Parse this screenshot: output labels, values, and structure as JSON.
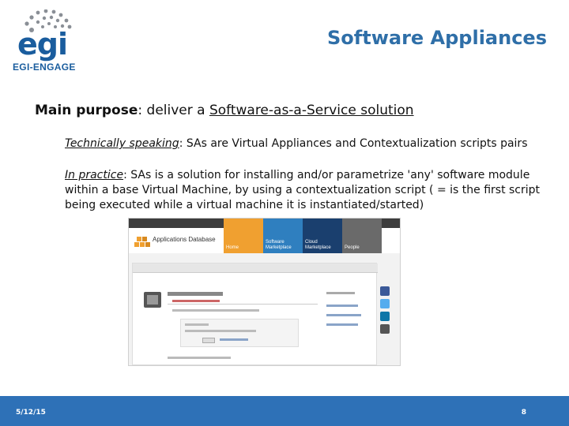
{
  "logo": {
    "brand": "egi",
    "subtitle": "EGI-ENGAGE",
    "color": "#1a5d9e"
  },
  "title": "Software Appliances",
  "main_purpose": {
    "label": "Main purpose",
    "text": ": deliver a ",
    "link": "Software-as-a-Service solution"
  },
  "bullets": {
    "technically": {
      "label": "Technically speaking",
      "text": ": SAs are Virtual Appliances and Contextualization scripts pairs"
    },
    "practice": {
      "label": "In practice",
      "text": ": SAs is a solution for installing and/or parametrize 'any' software module within a base Virtual Machine, by using a contextualization script ( = is the first script being executed while a virtual machine it is instantiated/started)"
    }
  },
  "screenshot": {
    "app_name": "Applications Database",
    "tiles": [
      "Home",
      "Software Marketplace",
      "Cloud Marketplace",
      "People"
    ]
  },
  "footer": {
    "date": "5/12/15",
    "page": "8",
    "color": "#2e71b7"
  }
}
